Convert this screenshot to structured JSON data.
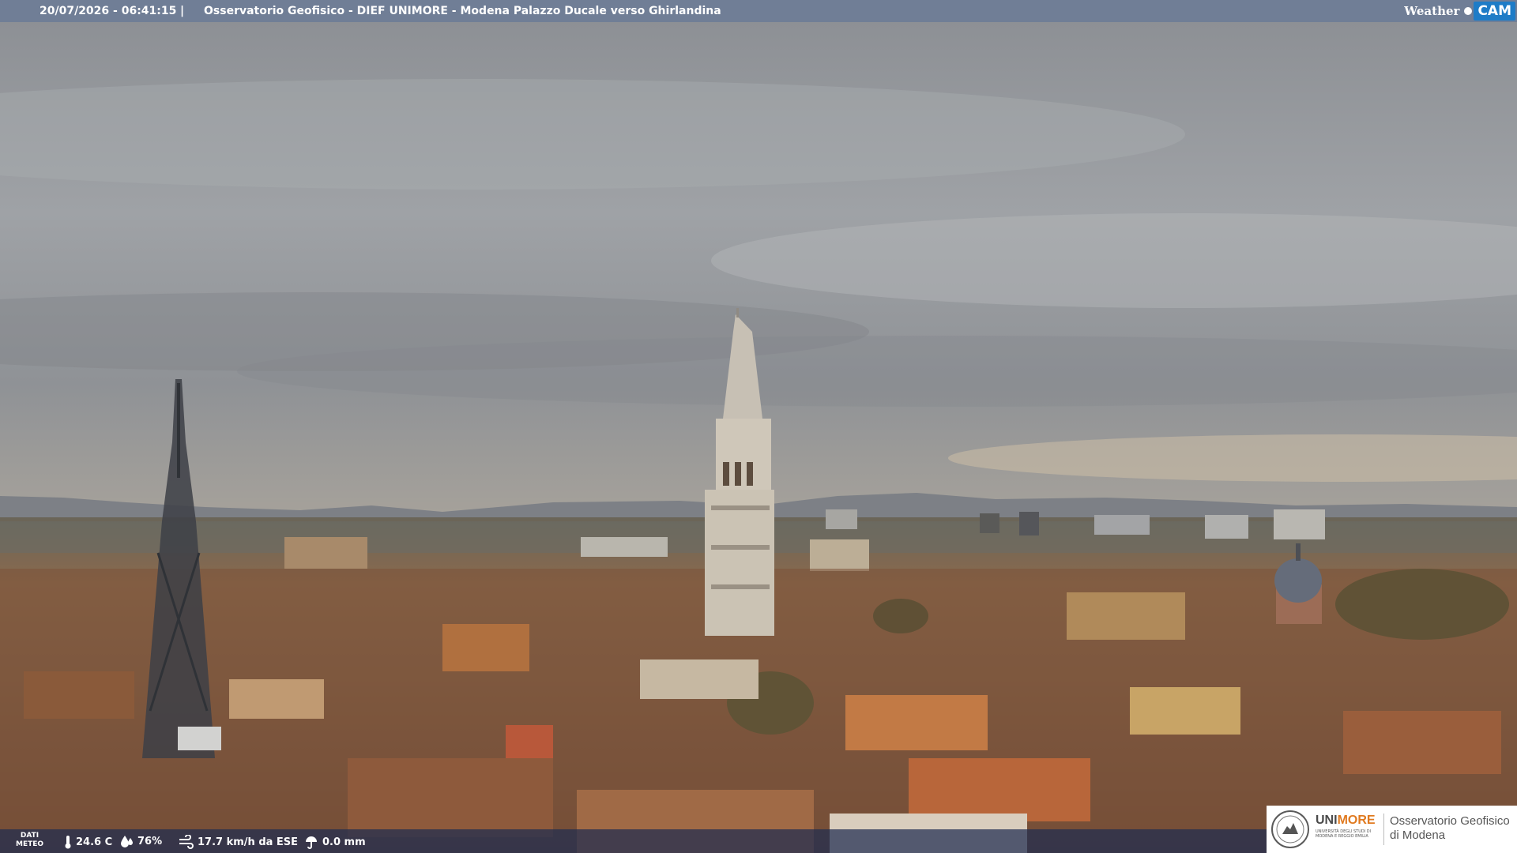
{
  "header": {
    "datetime": "20/07/2026 - 06:41:15",
    "separator": "|",
    "title": "Osservatorio Geofisico - DIEF UNIMORE - Modena Palazzo Ducale verso Ghirlandina",
    "brand_weather": "Weather",
    "brand_cam": "CAM"
  },
  "weather": {
    "label_line1": "DATI",
    "label_line2": "METEO",
    "temperature": "24.6 C",
    "humidity": "76%",
    "wind": "17.7 km/h da ESE",
    "rain": "0.0 mm",
    "icons": [
      "thermometer-icon",
      "humidity-drop-icon",
      "wind-icon",
      "rain-icon"
    ]
  },
  "logo": {
    "uni_part1": "UNI",
    "uni_part2": "MORE",
    "uni_subtitle": "Università degli studi di Modena e Reggio Emilia",
    "observatory_line1": "Osservatorio Geofisico",
    "observatory_line2": "di Modena"
  },
  "colors": {
    "topbar": "#6e7d96",
    "bottombar": "#1e2d50",
    "cam_blue": "#1e7cc7",
    "unimore_orange": "#e07a20"
  }
}
